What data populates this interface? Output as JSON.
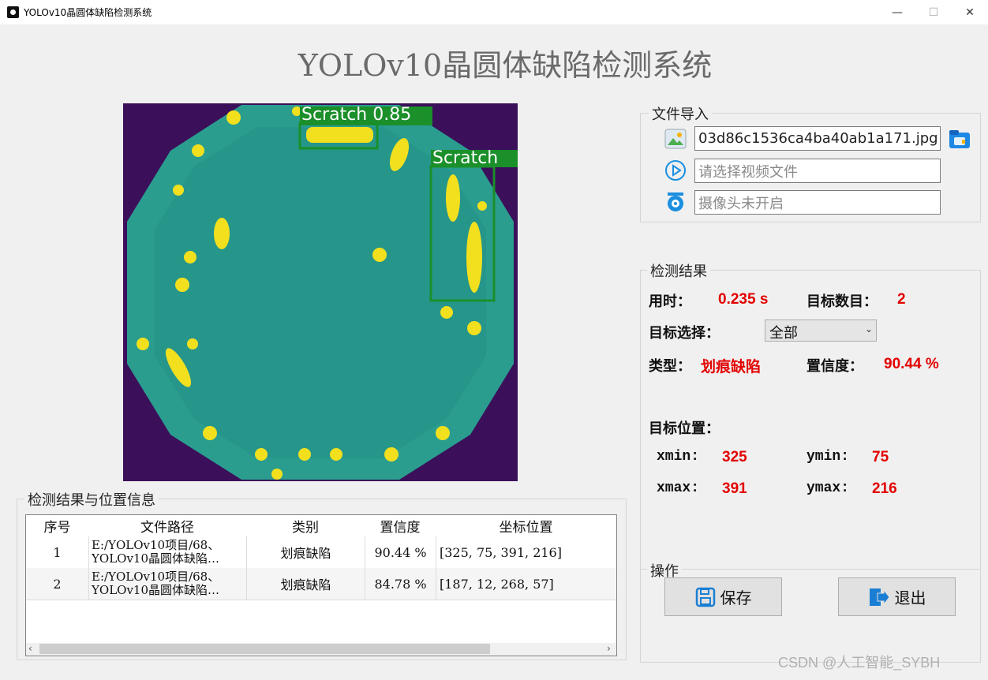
{
  "window": {
    "title": "YOLOv10晶圆体缺陷检测系统",
    "minimize": "—",
    "maximize": "☐",
    "close": "✕"
  },
  "page_title": "YOLOv10晶圆体缺陷检测系统",
  "image": {
    "detections": [
      {
        "label": "Scratch 0.85",
        "color": "#1a8f2a"
      },
      {
        "label": "Scratch",
        "color": "#1a8f2a"
      }
    ]
  },
  "file_import": {
    "title": "文件导入",
    "image_file": "03d86c1536ca4ba40ab1a171.jpg",
    "video_placeholder": "请选择视频文件",
    "camera_placeholder": "摄像头未开启",
    "icons": [
      "image-icon",
      "video-play-icon",
      "camera-icon",
      "folder-icon"
    ]
  },
  "results": {
    "title": "检测结果",
    "time_label": "用时：",
    "time_value": "0.235 s",
    "count_label": "目标数目：",
    "count_value": "2",
    "select_label": "目标选择：",
    "select_value": "全部",
    "type_label": "类型：",
    "type_value": "划痕缺陷",
    "conf_label": "置信度：",
    "conf_value": "90.44 %",
    "position_label": "目标位置：",
    "xmin_label": "xmin:",
    "xmin_value": "325",
    "ymin_label": "ymin:",
    "ymin_value": "75",
    "xmax_label": "xmax:",
    "xmax_value": "391",
    "ymax_label": "ymax:",
    "ymax_value": "216"
  },
  "operations": {
    "title": "操作",
    "save_label": "保存",
    "exit_label": "退出"
  },
  "table": {
    "title": "检测结果与位置信息",
    "headers": [
      "序号",
      "文件路径",
      "类别",
      "置信度",
      "坐标位置"
    ],
    "rows": [
      {
        "index": "1",
        "path": "E:/YOLOv10项目/68、\nYOLOv10晶圆体缺陷…",
        "category": "划痕缺陷",
        "confidence": "90.44 %",
        "coords": "[325, 75, 391, 216]"
      },
      {
        "index": "2",
        "path": "E:/YOLOv10项目/68、\nYOLOv10晶圆体缺陷…",
        "category": "划痕缺陷",
        "confidence": "84.78 %",
        "coords": "[187, 12, 268, 57]"
      }
    ]
  },
  "watermark": "CSDN @人工智能_SYBH",
  "colors": {
    "accent_red": "#e30000",
    "background": "#f0f0f0",
    "wafer_bg": "#3b0f5a",
    "wafer_teal": "#2a9d8f",
    "defect_yellow": "#f2e01e"
  }
}
